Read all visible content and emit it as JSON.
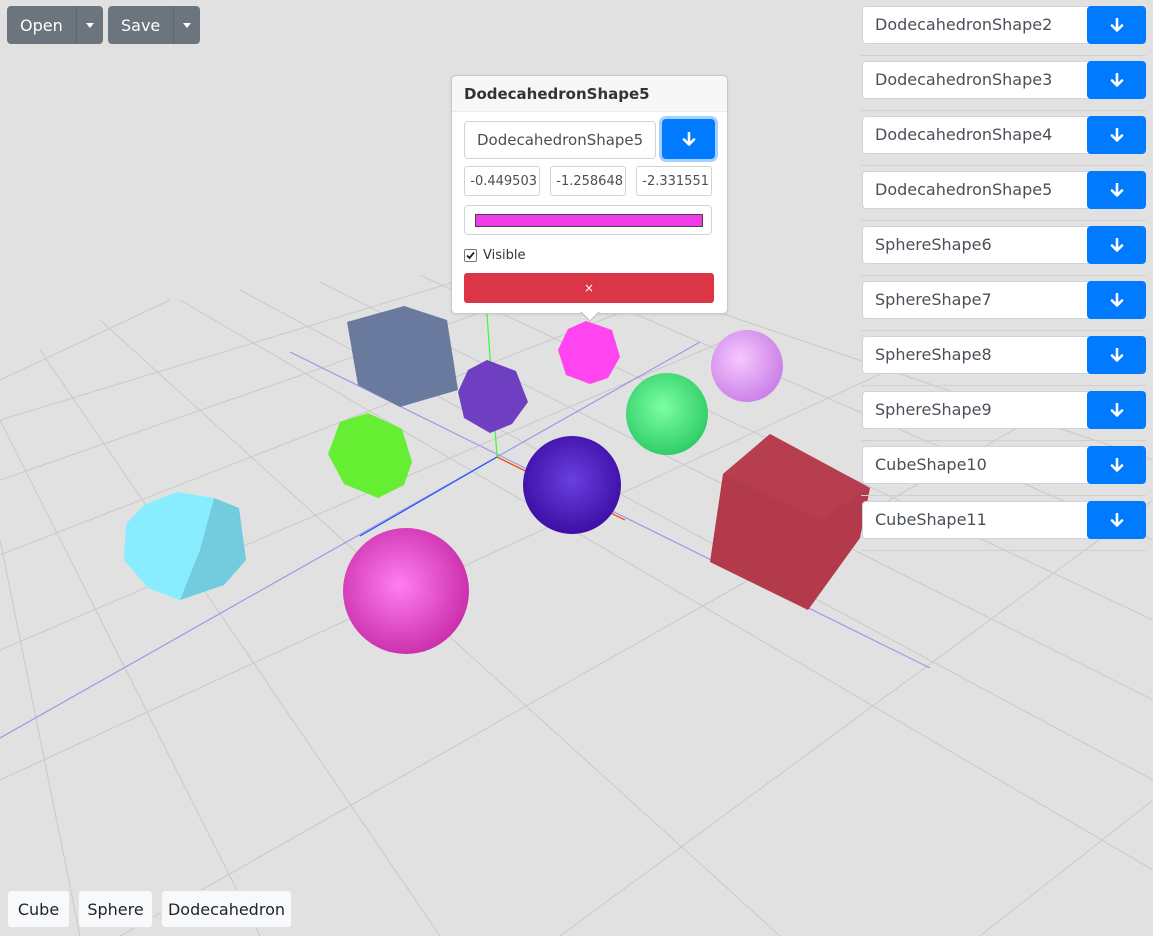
{
  "toolbar": {
    "open_label": "Open",
    "save_label": "Save"
  },
  "shape_list": {
    "items": [
      {
        "name": "DodecahedronShape2"
      },
      {
        "name": "DodecahedronShape3"
      },
      {
        "name": "DodecahedronShape4"
      },
      {
        "name": "DodecahedronShape5"
      },
      {
        "name": "SphereShape6"
      },
      {
        "name": "SphereShape7"
      },
      {
        "name": "SphereShape8"
      },
      {
        "name": "SphereShape9"
      },
      {
        "name": "CubeShape10"
      },
      {
        "name": "CubeShape11"
      }
    ],
    "download_icon": "arrow-down-icon"
  },
  "popover": {
    "title": "DodecahedronShape5",
    "name_value": "DodecahedronShape5",
    "x": "-0.449503",
    "y": "-1.258648",
    "z": "-2.331551",
    "color": "#f03ce8",
    "visible_label": "Visible",
    "visible": true,
    "delete_label": "×"
  },
  "add_buttons": {
    "cube": "Cube",
    "sphere": "Sphere",
    "dodecahedron": "Dodecahedron"
  },
  "scene": {
    "grid_color": "#c8c8c8",
    "axis_colors": {
      "x": "#ff3b00",
      "y": "#33ff33",
      "z": "#1e55ff"
    },
    "objects": [
      {
        "type": "cube",
        "color": "#6a7a9e"
      },
      {
        "type": "cube",
        "color": "#b23a4a"
      },
      {
        "type": "dodecahedron",
        "color": "#ff44f0"
      },
      {
        "type": "dodecahedron",
        "color": "#6e3fc0"
      },
      {
        "type": "dodecahedron",
        "color": "#66ee33"
      },
      {
        "type": "dodecahedron",
        "color": "#88eeff"
      },
      {
        "type": "sphere",
        "color": "#e79cf8"
      },
      {
        "type": "sphere",
        "color": "#44ee77"
      },
      {
        "type": "sphere",
        "color": "#4a14b8"
      },
      {
        "type": "sphere",
        "color": "#ee4cc8"
      }
    ]
  }
}
